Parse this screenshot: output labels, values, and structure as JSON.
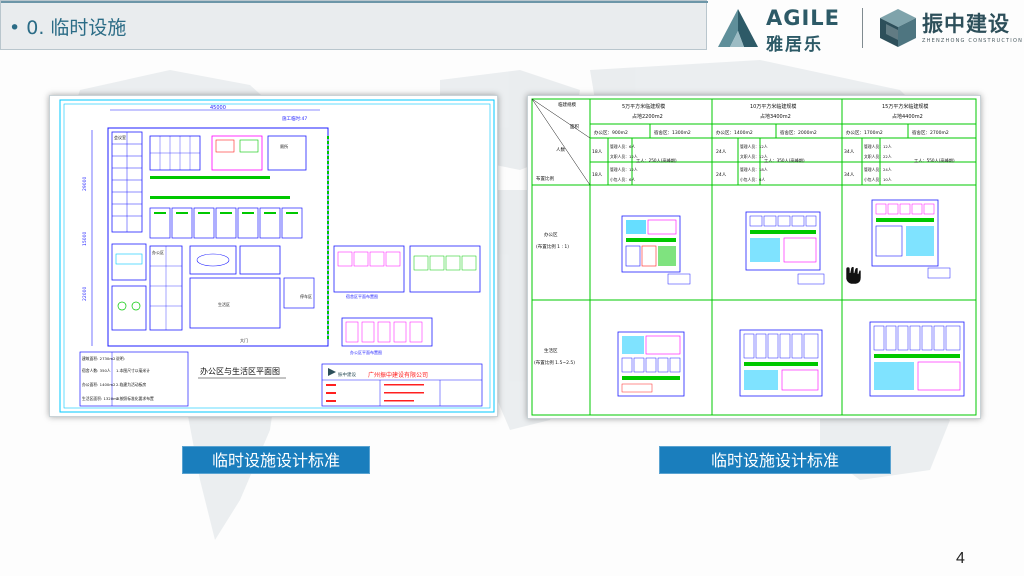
{
  "slide": {
    "title": "• 0. 临时设施",
    "page_number": "4"
  },
  "logos": {
    "agile_word": "AGILE",
    "agile_cn": "雅居乐",
    "zz_cn": "振中建设",
    "zz_en": "ZHENZHONG CONSTRUCTION"
  },
  "left_drawing": {
    "caption": "临时设施设计标准",
    "width_dim": "45000",
    "right_dim": "施工临时:47",
    "plan_title": "办公区与生活区平面图",
    "company_name": "广州振中建设有限公司",
    "company_logo_text": "振中建设",
    "left_dim_1": "29000",
    "left_dim_2": "15000",
    "left_dim_3": "22000",
    "label_meeting": "会议室",
    "label_office": "办公区",
    "label_living": "生活区",
    "label_wc": "厕所",
    "label_parking": "停车区",
    "label_gate": "大门",
    "label_dorm_detail": "宿舍区平面布置图",
    "label_office_detail": "办公区平面布置图",
    "legend_rows": [
      "建筑面积: 2730m2",
      "宿舍人数: 350人",
      "办公面积: 1400m2",
      "生活区面积: 1320m2"
    ],
    "notes_rows": [
      "说明:",
      "1.本图尺寸以毫米计",
      "2.临建为活动板房",
      "3.按照标准化要求布置"
    ]
  },
  "right_table": {
    "caption": "临时设施设计标准",
    "corner_top": "临建规模",
    "corner_mid": "面积",
    "corner_left_top": "人数",
    "corner_bottom": "布置比例",
    "columns": [
      {
        "title1": "5万平方米临建规模",
        "title2": "占地2200m2",
        "office_area": "办公区：900m2",
        "dorm_area": "宿舍区：1300m2",
        "staff": [
          {
            "count": "18人",
            "lines": [
              "管理人员：6人",
              "文职人员：12人"
            ]
          },
          {
            "count": "18人",
            "lines": [
              "管理人员：12人",
              "小包人员：6人"
            ]
          }
        ],
        "workers": "工人：250人(高峰期)"
      },
      {
        "title1": "10万平方米临建规模",
        "title2": "占地3400m2",
        "office_area": "办公区：1400m2",
        "dorm_area": "宿舍区：2000m2",
        "staff": [
          {
            "count": "24人",
            "lines": [
              "管理人员：12人",
              "文职人员：12人"
            ]
          },
          {
            "count": "24人",
            "lines": [
              "管理人员：18人",
              "小包人员：6人"
            ]
          }
        ],
        "workers": "工人：350人(高峰期)"
      },
      {
        "title1": "15万平方米临建规模",
        "title2": "占地4400m2",
        "office_area": "办公区：1700m2",
        "dorm_area": "宿舍区：2700m2",
        "staff": [
          {
            "count": "34人",
            "lines": [
              "管理人员：12人",
              "文职人员：22人"
            ]
          },
          {
            "count": "34人",
            "lines": [
              "管理人员：24人",
              "小包人员：10人"
            ]
          }
        ],
        "workers": "工人：550人(高峰期)"
      }
    ],
    "row_office_label_1": "办公区",
    "row_office_label_2": "(布置比例 1 : 1)",
    "row_dorm_label_1": "生活区",
    "row_dorm_label_2": "(布置比例 1.5~2.5)"
  },
  "colors": {
    "title_text": "#2b6c86",
    "caption_bg": "#1a7ebd",
    "cad_green": "#00c800",
    "cad_cyan": "#00c8ff",
    "cad_blue": "#1c1cff",
    "cad_magenta": "#ff00ff",
    "cad_red": "#ff2020"
  }
}
